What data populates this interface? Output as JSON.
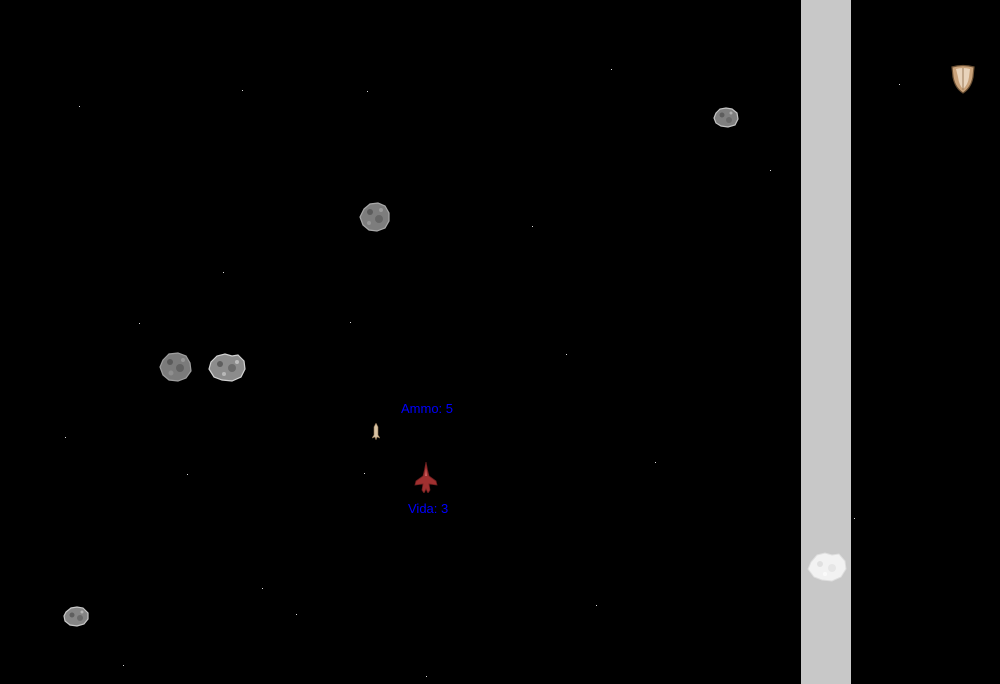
{
  "hud": {
    "ammo_label": "Ammo: 5",
    "life_label": "Vida: 3"
  },
  "colors": {
    "background": "#000000",
    "lane": "#c8c8c8",
    "hud_text": "#0000ff",
    "ship": "#a03030",
    "asteroid": "#8a8a8a",
    "asteroid_in_lane": "#f0f0f0",
    "shield_powerup": "#c9a27a"
  },
  "sprites": {
    "player": "red-starfighter-icon",
    "projectile": "missile-icon",
    "asteroid": "asteroid-icon",
    "powerup": "shield-icon"
  }
}
